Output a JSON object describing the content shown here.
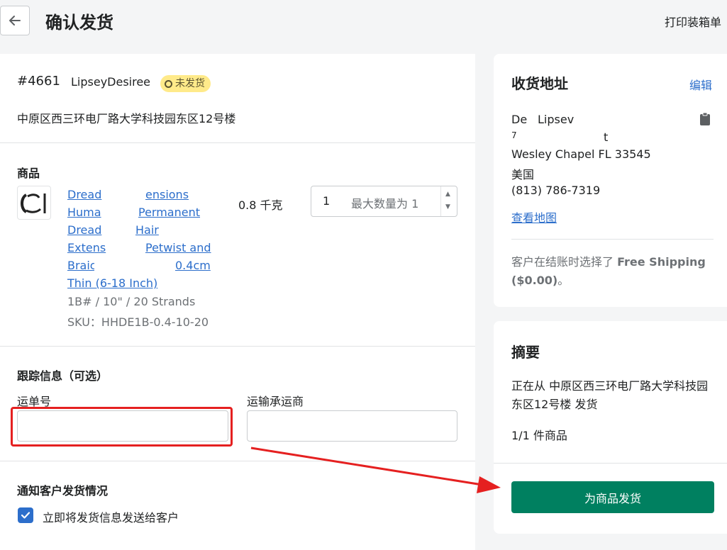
{
  "header": {
    "title": "确认发货",
    "print_label": "打印装箱单"
  },
  "order": {
    "number": "#4661",
    "customer": "LipseyDesiree",
    "status_badge": "未发货",
    "location": "中原区西三环电厂路大学科技园东区12号楼"
  },
  "products": {
    "heading": "商品",
    "item": {
      "title_lines": [
        "Dread",
        "ensions",
        "Huma",
        "Permanent",
        "Dread",
        "Hair",
        "Extens",
        "Petwist and",
        "Braic",
        "0.4cm",
        "Thin (6-18 Inch)"
      ],
      "variant": "1B# / 10\" / 20 Strands",
      "sku": "SKU：HHDE1B-0.4-10-20",
      "weight": "0.8 千克",
      "quantity": "1",
      "max_quantity": "最大数量为 1"
    }
  },
  "tracking": {
    "heading": "跟踪信息（可选）",
    "tracking_number_label": "运单号",
    "tracking_number_value": "",
    "carrier_label": "运输承运商",
    "carrier_value": ""
  },
  "notify": {
    "heading": "通知客户发货情况",
    "checkbox_label": "立即将发货信息发送给客户",
    "checked": true
  },
  "shipping_address": {
    "heading": "收货地址",
    "edit_label": "编辑",
    "line_name_a": "De",
    "line_name_b": "Lipsev",
    "line_street_a": "7",
    "line_street_b": "t",
    "city_line": "Wesley Chapel FL 33545",
    "country": "美国",
    "phone": "(813) 786-7319",
    "map_link": "查看地图",
    "shipping_note_prefix": "客户在结账时选择了 ",
    "shipping_method": "Free Shipping ($0.00)",
    "shipping_note_suffix": "。"
  },
  "summary": {
    "heading": "摘要",
    "shipping_from": "正在从 中原区西三环电厂路大学科技园东区12号楼 发货",
    "item_count": "1/1 件商品",
    "fulfill_button": "为商品发货"
  },
  "colors": {
    "primary": "#008060",
    "link": "#2c6ecb",
    "badge_bg": "#ffea8a",
    "highlight": "#e52020"
  }
}
